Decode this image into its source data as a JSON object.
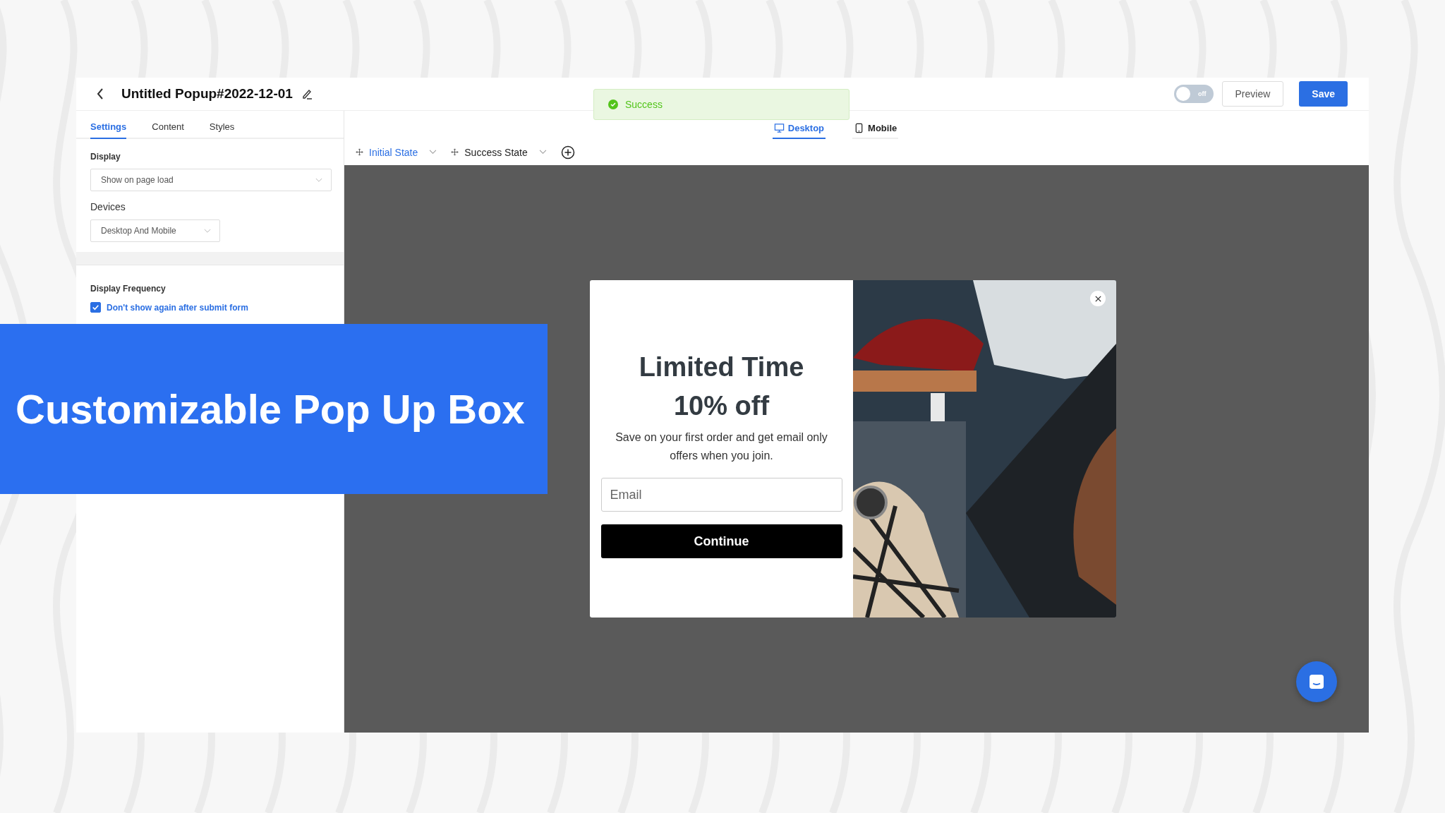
{
  "header": {
    "title": "Untitled Popup#2022-12-01",
    "toggle": {
      "label": "off",
      "on": false
    },
    "buttons": [
      {
        "label": "Preview",
        "kind": "secondary"
      },
      {
        "label": "Save",
        "kind": "primary"
      }
    ]
  },
  "toast": {
    "text": "Success"
  },
  "sidebar": {
    "tabs": [
      {
        "label": "Settings",
        "selected": true
      },
      {
        "label": "Content",
        "selected": false
      },
      {
        "label": "Styles",
        "selected": false
      }
    ],
    "display": {
      "label": "Display",
      "value": "Show on page load"
    },
    "devices": {
      "label": "Devices",
      "value": "Desktop And Mobile"
    },
    "frequency": {
      "label": "Display Frequency",
      "option": {
        "label": "Don't show again after submit form",
        "checked": true
      }
    }
  },
  "device_tabs": [
    {
      "label": "Desktop",
      "kind": "desktop",
      "selected": true
    },
    {
      "label": "Mobile",
      "kind": "mobile",
      "selected": false
    }
  ],
  "states": [
    {
      "label": "Initial State",
      "selected": true
    },
    {
      "label": "Success State",
      "selected": false
    }
  ],
  "popup": {
    "title": "Limited Time",
    "subtitle": "10% off",
    "body": "Save on your first order and get email only offers when you join.",
    "email": {
      "placeholder": "Email"
    },
    "button": "Continue"
  },
  "banner": {
    "text": "Customizable Pop Up Box"
  }
}
